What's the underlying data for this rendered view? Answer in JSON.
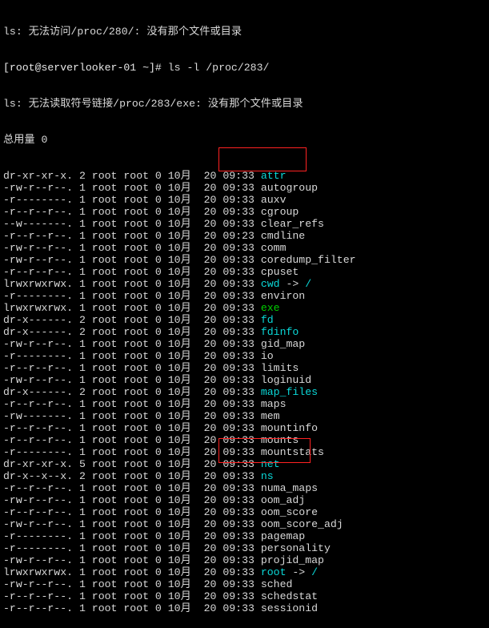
{
  "line1": "ls: 无法访问/proc/280/: 没有那个文件或目录",
  "prompt_user": "[root@serverlooker-01 ~]#",
  "command": " ls -l /proc/283/",
  "line3": "ls: 无法读取符号链接/proc/283/exe: 没有那个文件或目录",
  "total": "总用量 0",
  "entries": [
    {
      "perm": "dr-xr-xr-x.",
      "l": "2",
      "o": "root",
      "g": "root",
      "s": "0",
      "d": "10月  20 09:33",
      "name": "attr",
      "cls": "teal",
      "suf": ""
    },
    {
      "perm": "-rw-r--r--.",
      "l": "1",
      "o": "root",
      "g": "root",
      "s": "0",
      "d": "10月  20 09:33",
      "name": "autogroup",
      "cls": "",
      "suf": ""
    },
    {
      "perm": "-r--------.",
      "l": "1",
      "o": "root",
      "g": "root",
      "s": "0",
      "d": "10月  20 09:33",
      "name": "auxv",
      "cls": "",
      "suf": ""
    },
    {
      "perm": "-r--r--r--.",
      "l": "1",
      "o": "root",
      "g": "root",
      "s": "0",
      "d": "10月  20 09:33",
      "name": "cgroup",
      "cls": "",
      "suf": ""
    },
    {
      "perm": "--w-------.",
      "l": "1",
      "o": "root",
      "g": "root",
      "s": "0",
      "d": "10月  20 09:33",
      "name": "clear_refs",
      "cls": "",
      "suf": ""
    },
    {
      "perm": "-r--r--r--.",
      "l": "1",
      "o": "root",
      "g": "root",
      "s": "0",
      "d": "10月  20 09:23",
      "name": "cmdline",
      "cls": "",
      "suf": ""
    },
    {
      "perm": "-rw-r--r--.",
      "l": "1",
      "o": "root",
      "g": "root",
      "s": "0",
      "d": "10月  20 09:33",
      "name": "comm",
      "cls": "",
      "suf": ""
    },
    {
      "perm": "-rw-r--r--.",
      "l": "1",
      "o": "root",
      "g": "root",
      "s": "0",
      "d": "10月  20 09:33",
      "name": "coredump_filter",
      "cls": "",
      "suf": ""
    },
    {
      "perm": "-r--r--r--.",
      "l": "1",
      "o": "root",
      "g": "root",
      "s": "0",
      "d": "10月  20 09:33",
      "name": "cpuset",
      "cls": "",
      "suf": ""
    },
    {
      "perm": "lrwxrwxrwx.",
      "l": "1",
      "o": "root",
      "g": "root",
      "s": "0",
      "d": "10月  20 09:33",
      "name": "cwd",
      "cls": "teal",
      "suf": " -> /"
    },
    {
      "perm": "-r--------.",
      "l": "1",
      "o": "root",
      "g": "root",
      "s": "0",
      "d": "10月  20 09:33",
      "name": "environ",
      "cls": "",
      "suf": ""
    },
    {
      "perm": "lrwxrwxrwx.",
      "l": "1",
      "o": "root",
      "g": "root",
      "s": "0",
      "d": "10月  20 09:33",
      "name": "exe",
      "cls": "green",
      "suf": ""
    },
    {
      "perm": "dr-x------.",
      "l": "2",
      "o": "root",
      "g": "root",
      "s": "0",
      "d": "10月  20 09:33",
      "name": "fd",
      "cls": "teal",
      "suf": ""
    },
    {
      "perm": "dr-x------.",
      "l": "2",
      "o": "root",
      "g": "root",
      "s": "0",
      "d": "10月  20 09:33",
      "name": "fdinfo",
      "cls": "teal",
      "suf": ""
    },
    {
      "perm": "-rw-r--r--.",
      "l": "1",
      "o": "root",
      "g": "root",
      "s": "0",
      "d": "10月  20 09:33",
      "name": "gid_map",
      "cls": "",
      "suf": ""
    },
    {
      "perm": "-r--------.",
      "l": "1",
      "o": "root",
      "g": "root",
      "s": "0",
      "d": "10月  20 09:33",
      "name": "io",
      "cls": "",
      "suf": ""
    },
    {
      "perm": "-r--r--r--.",
      "l": "1",
      "o": "root",
      "g": "root",
      "s": "0",
      "d": "10月  20 09:33",
      "name": "limits",
      "cls": "",
      "suf": ""
    },
    {
      "perm": "-rw-r--r--.",
      "l": "1",
      "o": "root",
      "g": "root",
      "s": "0",
      "d": "10月  20 09:33",
      "name": "loginuid",
      "cls": "",
      "suf": ""
    },
    {
      "perm": "dr-x------.",
      "l": "2",
      "o": "root",
      "g": "root",
      "s": "0",
      "d": "10月  20 09:33",
      "name": "map_files",
      "cls": "teal",
      "suf": ""
    },
    {
      "perm": "-r--r--r--.",
      "l": "1",
      "o": "root",
      "g": "root",
      "s": "0",
      "d": "10月  20 09:33",
      "name": "maps",
      "cls": "",
      "suf": ""
    },
    {
      "perm": "-rw-------.",
      "l": "1",
      "o": "root",
      "g": "root",
      "s": "0",
      "d": "10月  20 09:33",
      "name": "mem",
      "cls": "",
      "suf": ""
    },
    {
      "perm": "-r--r--r--.",
      "l": "1",
      "o": "root",
      "g": "root",
      "s": "0",
      "d": "10月  20 09:33",
      "name": "mountinfo",
      "cls": "",
      "suf": ""
    },
    {
      "perm": "-r--r--r--.",
      "l": "1",
      "o": "root",
      "g": "root",
      "s": "0",
      "d": "10月  20 09:33",
      "name": "mounts",
      "cls": "",
      "suf": ""
    },
    {
      "perm": "-r--------.",
      "l": "1",
      "o": "root",
      "g": "root",
      "s": "0",
      "d": "10月  20 09:33",
      "name": "mountstats",
      "cls": "",
      "suf": ""
    },
    {
      "perm": "dr-xr-xr-x.",
      "l": "5",
      "o": "root",
      "g": "root",
      "s": "0",
      "d": "10月  20 09:33",
      "name": "net",
      "cls": "teal",
      "suf": ""
    },
    {
      "perm": "dr-x--x--x.",
      "l": "2",
      "o": "root",
      "g": "root",
      "s": "0",
      "d": "10月  20 09:33",
      "name": "ns",
      "cls": "teal",
      "suf": ""
    },
    {
      "perm": "-r--r--r--.",
      "l": "1",
      "o": "root",
      "g": "root",
      "s": "0",
      "d": "10月  20 09:33",
      "name": "numa_maps",
      "cls": "",
      "suf": ""
    },
    {
      "perm": "-rw-r--r--.",
      "l": "1",
      "o": "root",
      "g": "root",
      "s": "0",
      "d": "10月  20 09:33",
      "name": "oom_adj",
      "cls": "",
      "suf": ""
    },
    {
      "perm": "-r--r--r--.",
      "l": "1",
      "o": "root",
      "g": "root",
      "s": "0",
      "d": "10月  20 09:33",
      "name": "oom_score",
      "cls": "",
      "suf": ""
    },
    {
      "perm": "-rw-r--r--.",
      "l": "1",
      "o": "root",
      "g": "root",
      "s": "0",
      "d": "10月  20 09:33",
      "name": "oom_score_adj",
      "cls": "",
      "suf": ""
    },
    {
      "perm": "-r--------.",
      "l": "1",
      "o": "root",
      "g": "root",
      "s": "0",
      "d": "10月  20 09:33",
      "name": "pagemap",
      "cls": "",
      "suf": ""
    },
    {
      "perm": "-r--------.",
      "l": "1",
      "o": "root",
      "g": "root",
      "s": "0",
      "d": "10月  20 09:33",
      "name": "personality",
      "cls": "",
      "suf": ""
    },
    {
      "perm": "-rw-r--r--.",
      "l": "1",
      "o": "root",
      "g": "root",
      "s": "0",
      "d": "10月  20 09:33",
      "name": "projid_map",
      "cls": "",
      "suf": ""
    },
    {
      "perm": "lrwxrwxrwx.",
      "l": "1",
      "o": "root",
      "g": "root",
      "s": "0",
      "d": "10月  20 09:33",
      "name": "root",
      "cls": "teal",
      "suf": " -> /"
    },
    {
      "perm": "-rw-r--r--.",
      "l": "1",
      "o": "root",
      "g": "root",
      "s": "0",
      "d": "10月  20 09:33",
      "name": "sched",
      "cls": "",
      "suf": ""
    },
    {
      "perm": "-r--r--r--.",
      "l": "1",
      "o": "root",
      "g": "root",
      "s": "0",
      "d": "10月  20 09:33",
      "name": "schedstat",
      "cls": "",
      "suf": ""
    },
    {
      "perm": "-r--r--r--.",
      "l": "1",
      "o": "root",
      "g": "root",
      "s": "0",
      "d": "10月  20 09:33",
      "name": "sessionid",
      "cls": "",
      "suf": ""
    }
  ]
}
